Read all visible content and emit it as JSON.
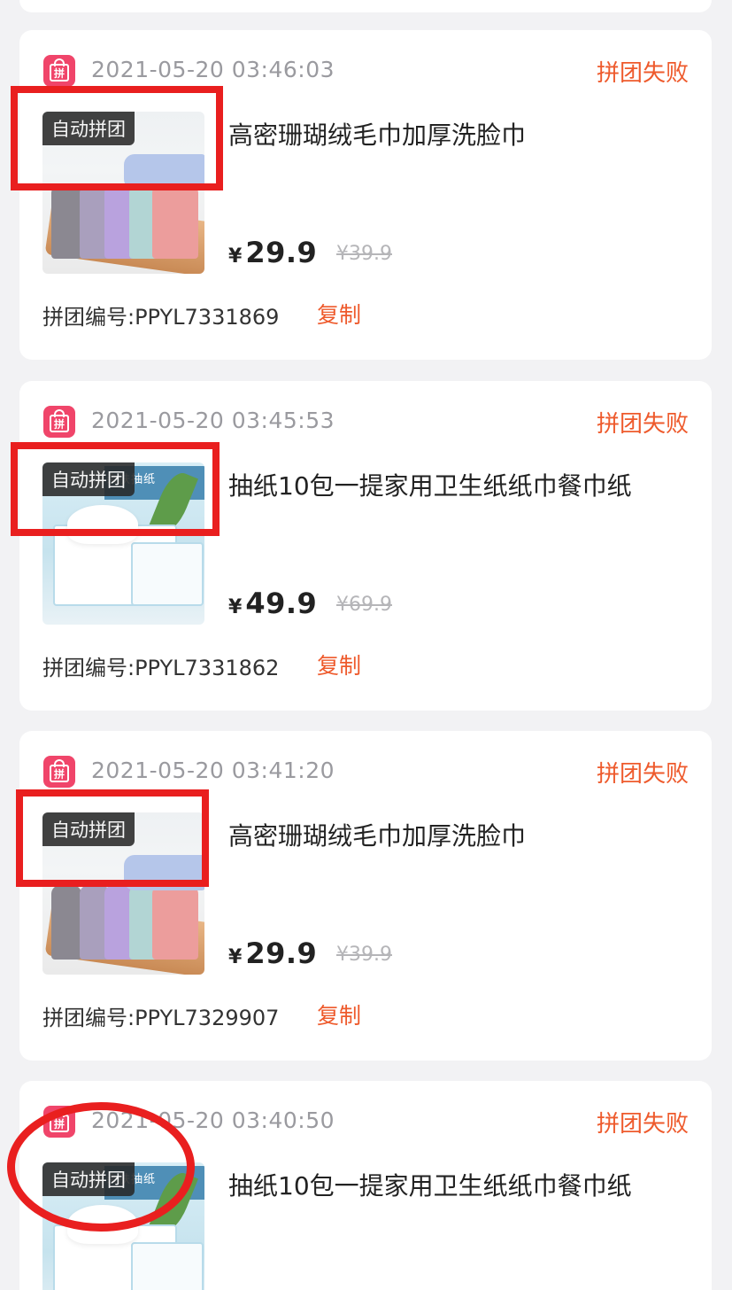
{
  "orders": [
    {
      "time": "2021-05-20 03:46:03",
      "status": "拼团失败",
      "tag": "自动拼团",
      "title": "高密珊瑚绒毛巾加厚洗脸巾",
      "currency": "¥",
      "price": "29.9",
      "original_price": "¥39.9",
      "group_number": "拼团编号:PPYL7331869",
      "copy_label": "复制",
      "thumbnail": "towel"
    },
    {
      "time": "2021-05-20 03:45:53",
      "status": "拼团失败",
      "tag": "自动拼团",
      "title": "抽纸10包一提家用卫生纸纸巾餐巾纸",
      "currency": "¥",
      "price": "49.9",
      "original_price": "¥69.9",
      "group_number": "拼团编号:PPYL7331862",
      "copy_label": "复制",
      "thumbnail": "tissue"
    },
    {
      "time": "2021-05-20 03:41:20",
      "status": "拼团失败",
      "tag": "自动拼团",
      "title": "高密珊瑚绒毛巾加厚洗脸巾",
      "currency": "¥",
      "price": "29.9",
      "original_price": "¥39.9",
      "group_number": "拼团编号:PPYL7329907",
      "copy_label": "复制",
      "thumbnail": "towel"
    },
    {
      "time": "2021-05-20 03:40:50",
      "status": "拼团失败",
      "tag": "自动拼团",
      "title": "抽纸10包一提家用卫生纸纸巾餐巾纸",
      "thumbnail": "tissue"
    }
  ],
  "shop_icon_glyph": "拼",
  "tissue_pack_text": "亲肤抽纸",
  "colors": {
    "accent": "#ee5a2c",
    "shop_icon": "#f0456a",
    "annotation_red": "#e91f1f"
  }
}
